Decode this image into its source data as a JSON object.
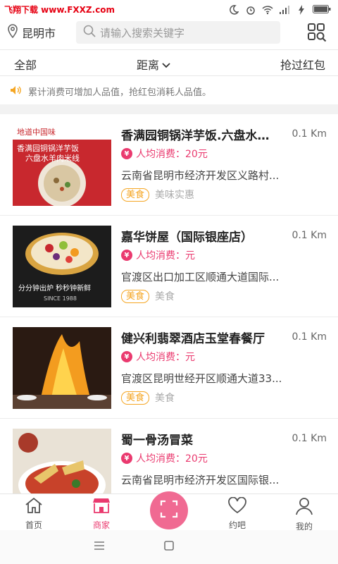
{
  "status_bar": {
    "watermark": "飞翔下载 www.FXXZ.com"
  },
  "header": {
    "city": "昆明市",
    "search_placeholder": "请输入搜索关键字"
  },
  "filters": {
    "all": "全部",
    "distance": "距离",
    "grabbed": "抢过红包"
  },
  "notice": "累计消费可增加人品值，抢红包消耗人品值。",
  "items": [
    {
      "name": "香满园铜锅洋芋饭.六盘水羊肉米线",
      "distance": "0.1 Km",
      "price": "人均消费：20元",
      "address": "云南省昆明市经济开发区义路村...",
      "tag": "美食",
      "sub": "美味实惠",
      "image_text1": "地道中国味",
      "image_text2": "香满园铜锅洋芋饭",
      "image_text3": "六盘水羊肉米线"
    },
    {
      "name": "嘉华饼屋（国际银座店）",
      "distance": "0.1 Km",
      "price": "人均消费：元",
      "address": "官渡区出口加工区顺通大道国际...",
      "tag": "美食",
      "sub": "美食",
      "image_text1": "分分钟出炉  秒秒钟新鲜",
      "image_text2": "SINCE 1988"
    },
    {
      "name": "健兴利翡翠酒店玉堂春餐厅",
      "distance": "0.1 Km",
      "price": "人均消费：元",
      "address": "官渡区昆明世经开区顺通大道33...",
      "tag": "美食",
      "sub": "美食"
    },
    {
      "name": "蜀一骨汤冒菜",
      "distance": "0.1 Km",
      "price": "人均消费：20元",
      "address": "云南省昆明市经济开发区国际银...",
      "tag": "美食",
      "sub": "美食"
    }
  ],
  "tabs": [
    {
      "label": "首页"
    },
    {
      "label": "商家"
    },
    {
      "label": "约吧"
    },
    {
      "label": "我的"
    }
  ],
  "colors": {
    "accent": "#ea3a6f",
    "tag": "#f5a623"
  }
}
